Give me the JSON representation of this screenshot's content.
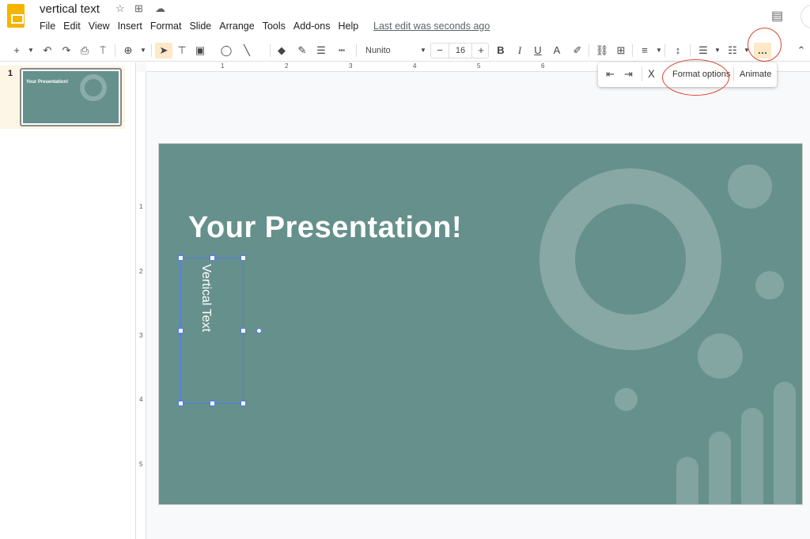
{
  "doc": {
    "title": "vertical text",
    "last_edit": "Last edit was seconds ago"
  },
  "menu": [
    "File",
    "Edit",
    "View",
    "Insert",
    "Format",
    "Slide",
    "Arrange",
    "Tools",
    "Add-ons",
    "Help"
  ],
  "toolbar": {
    "font": "Nunito",
    "font_size": "16",
    "more": "…"
  },
  "ruler": {
    "h": [
      "1",
      "2",
      "3",
      "4",
      "5",
      "6"
    ],
    "v": [
      "1",
      "2",
      "3",
      "4",
      "5"
    ]
  },
  "popup": {
    "format_options": "Format options",
    "animate": "Animate"
  },
  "filmstrip": {
    "slide_number": "1",
    "thumb_title": "Your Presentation!"
  },
  "slide": {
    "title": "Your Presentation!",
    "vertical_text": "Vertical Text",
    "background": "#66908c"
  },
  "colors": {
    "selection": "#4d7cf5",
    "annotation": "#e0432c",
    "highlight": "#fde9c8"
  }
}
